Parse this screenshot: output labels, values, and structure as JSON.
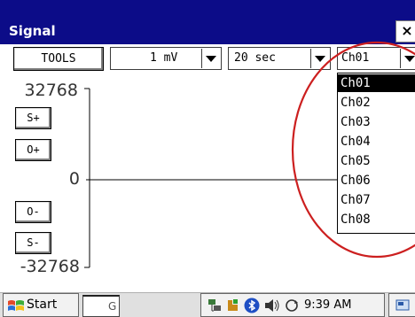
{
  "window": {
    "title": "Signal",
    "close_glyph": "×"
  },
  "toolbar": {
    "tools_label": "TOOLS",
    "scale_value": "1 mV",
    "time_value": "20 sec",
    "channel_value": "Ch01"
  },
  "channel_options": [
    "Ch01",
    "Ch02",
    "Ch03",
    "Ch04",
    "Ch05",
    "Ch06",
    "Ch07",
    "Ch08"
  ],
  "selected_channel_index": 0,
  "axis": {
    "y_max": "32768",
    "y_zero": "0",
    "y_min": "-32768"
  },
  "side_buttons": {
    "scale_up": "S+",
    "offset_up": "O+",
    "offset_down": "O-",
    "scale_down": "S-"
  },
  "taskbar": {
    "start_label": "Start",
    "app_partial": "G",
    "clock": "9:39 AM"
  },
  "colors": {
    "titlebar": "#0c0c88",
    "annotation_circle": "#cc1f1f",
    "selected_item": "#000000"
  },
  "icons": {
    "start": "windows-flag-icon",
    "tray": [
      "network-icon",
      "power-icon",
      "bluetooth-icon",
      "volume-icon",
      "sync-icon"
    ],
    "desktop": "desktop-icon"
  }
}
